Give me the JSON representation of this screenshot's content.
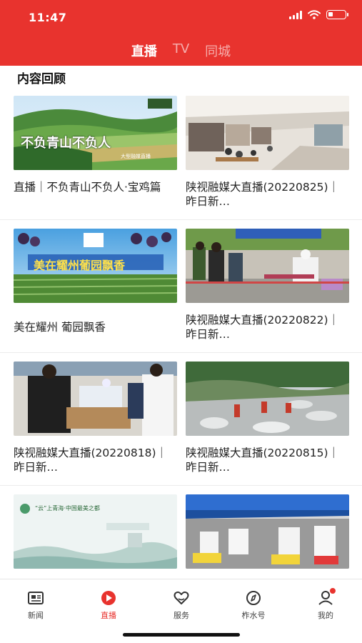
{
  "status_bar": {
    "time": "11:47"
  },
  "header": {
    "tabs": [
      {
        "label": "直播",
        "active": true
      },
      {
        "label": "TV",
        "active": false
      },
      {
        "label": "同城",
        "active": false
      }
    ]
  },
  "section": {
    "title": "内容回顾"
  },
  "cards": [
    {
      "title": "直播｜不负青山不负人·宝鸡篇",
      "thumb_text": "不负青山不负人",
      "thumb_caption": "大型融媒直播"
    },
    {
      "title": "陕视融媒大直播(20220825)｜昨日新…"
    },
    {
      "title": "美在耀州 葡园飘香",
      "thumb_text": "美在耀州葡园飘香"
    },
    {
      "title": "陕视融媒大直播(20220822)｜昨日新…"
    },
    {
      "title": "陕视融媒大直播(20220818)｜ 昨日新…"
    },
    {
      "title": "陕视融媒大直播(20220815)｜ 昨日新…"
    },
    {
      "title": "",
      "thumb_text": "“云”上青海·中国最美之都"
    },
    {
      "title": ""
    }
  ],
  "bottom_nav": [
    {
      "label": "新闻",
      "icon": "news-icon",
      "active": false
    },
    {
      "label": "直播",
      "icon": "play-icon",
      "active": true
    },
    {
      "label": "服务",
      "icon": "service-icon",
      "active": false
    },
    {
      "label": "柞水号",
      "icon": "compass-icon",
      "active": false
    },
    {
      "label": "我的",
      "icon": "profile-icon",
      "active": false
    }
  ],
  "colors": {
    "brand_red": "#e8332e"
  }
}
